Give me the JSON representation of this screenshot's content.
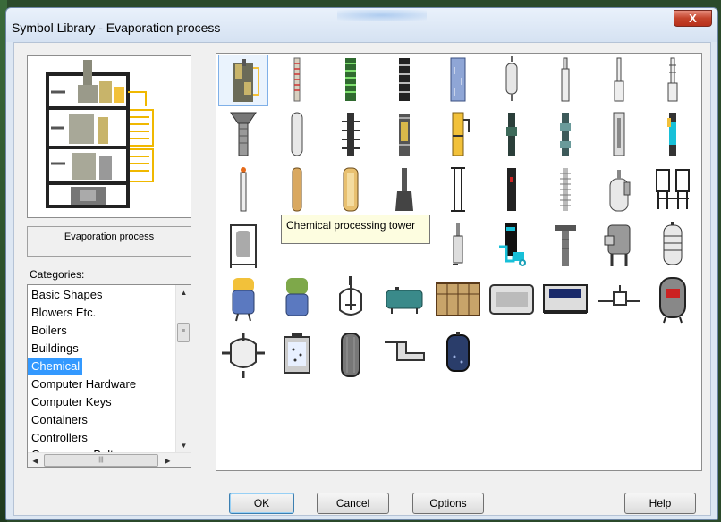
{
  "window": {
    "title": "Symbol Library - Evaporation process",
    "close_label": "X"
  },
  "preview": {
    "name": "Evaporation process"
  },
  "categories": {
    "label": "Categories:",
    "items": [
      "Basic Shapes",
      "Blowers Etc.",
      "Boilers",
      "Buildings",
      "Chemical",
      "Computer Hardware",
      "Computer Keys",
      "Containers",
      "Controllers",
      "Conveyors, Belt"
    ],
    "selected": "Chemical"
  },
  "tooltip": {
    "text": "Chemical processing tower"
  },
  "buttons": {
    "ok": "OK",
    "cancel": "Cancel",
    "options": "Options",
    "help": "Help"
  },
  "colors": {
    "selection": "#3399ff",
    "tooltip_bg": "#fdfde0",
    "tank_blue": "#5b79c0",
    "tank_green": "#7ea84a",
    "accent_cyan": "#18c0d8",
    "accent_yellow": "#f2c13a"
  }
}
